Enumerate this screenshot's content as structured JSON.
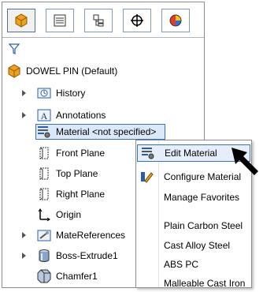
{
  "toolbar": {
    "tabs": [
      {
        "icon": "feature-manager-icon",
        "active": true
      },
      {
        "icon": "property-manager-icon",
        "active": false
      },
      {
        "icon": "configuration-manager-icon",
        "active": false
      },
      {
        "icon": "dimxpert-icon",
        "active": false
      },
      {
        "icon": "display-manager-icon",
        "active": false
      }
    ]
  },
  "tree": {
    "root_label": "DOWEL PIN  (Default)",
    "items": [
      {
        "label": "History",
        "icon": "history-icon",
        "expandable": true
      },
      {
        "label": "Annotations",
        "icon": "annotations-icon",
        "expandable": true
      },
      {
        "label": "Material <not specified>",
        "icon": "material-icon",
        "expandable": false,
        "selected": true
      },
      {
        "label": "Front Plane",
        "icon": "plane-icon",
        "expandable": false
      },
      {
        "label": "Top Plane",
        "icon": "plane-icon",
        "expandable": false
      },
      {
        "label": "Right Plane",
        "icon": "plane-icon",
        "expandable": false
      },
      {
        "label": "Origin",
        "icon": "origin-icon",
        "expandable": false
      },
      {
        "label": "MateReferences",
        "icon": "mate-references-icon",
        "expandable": true
      },
      {
        "label": "Boss-Extrude1",
        "icon": "boss-extrude-icon",
        "expandable": true
      },
      {
        "label": "Chamfer1",
        "icon": "chamfer-icon",
        "expandable": false
      }
    ]
  },
  "context_menu": {
    "items": [
      {
        "label": "Edit Material",
        "icon": "edit-material-icon",
        "highlighted": true
      },
      {
        "label": "Configure Material",
        "icon": "configure-material-icon"
      },
      {
        "label": "Manage Favorites",
        "icon": ""
      },
      {
        "label": "Plain Carbon Steel",
        "icon": ""
      },
      {
        "label": "Cast Alloy Steel",
        "icon": ""
      },
      {
        "label": "ABS PC",
        "icon": ""
      },
      {
        "label": "Malleable Cast Iron",
        "icon": ""
      }
    ]
  },
  "colors": {
    "accent": "#3b6fb6",
    "selection_bg": "#dbe8fa",
    "part_orange": "#f0a020"
  }
}
